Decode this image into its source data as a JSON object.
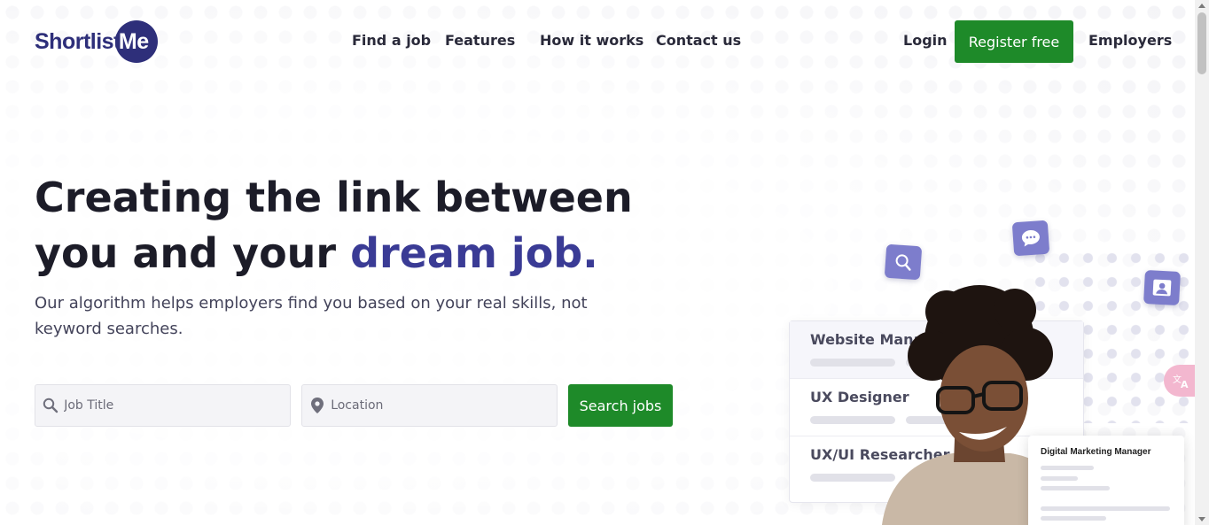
{
  "logo": {
    "text_main": "Shortlist",
    "text_circle": "Me"
  },
  "nav": {
    "items": [
      {
        "label": "Find a job"
      },
      {
        "label": "Features"
      },
      {
        "label": "How it works"
      },
      {
        "label": "Contact us"
      }
    ],
    "login": "Login",
    "register": "Register free",
    "employers": "Employers"
  },
  "hero": {
    "title_line1": "Creating the link between",
    "title_line2_plain": "you and your ",
    "title_line2_accent": "dream job.",
    "subtitle": "Our algorithm helps employers find you based on your real skills, not keyword searches."
  },
  "search": {
    "job_title_placeholder": "Job Title",
    "location_placeholder": "Location",
    "button": "Search jobs"
  },
  "illustration": {
    "jobs": [
      "Website Manager",
      "UX Designer",
      "UX/UI Researcher"
    ],
    "mini_card_title": "Digital Marketing Manager",
    "icons": [
      "search-icon",
      "chat-icon",
      "user-icon"
    ]
  },
  "colors": {
    "brand": "#2e2f7a",
    "accent": "#3a3b95",
    "primary_button": "#1e8a29",
    "icon_tile": "#7d7dcc"
  }
}
